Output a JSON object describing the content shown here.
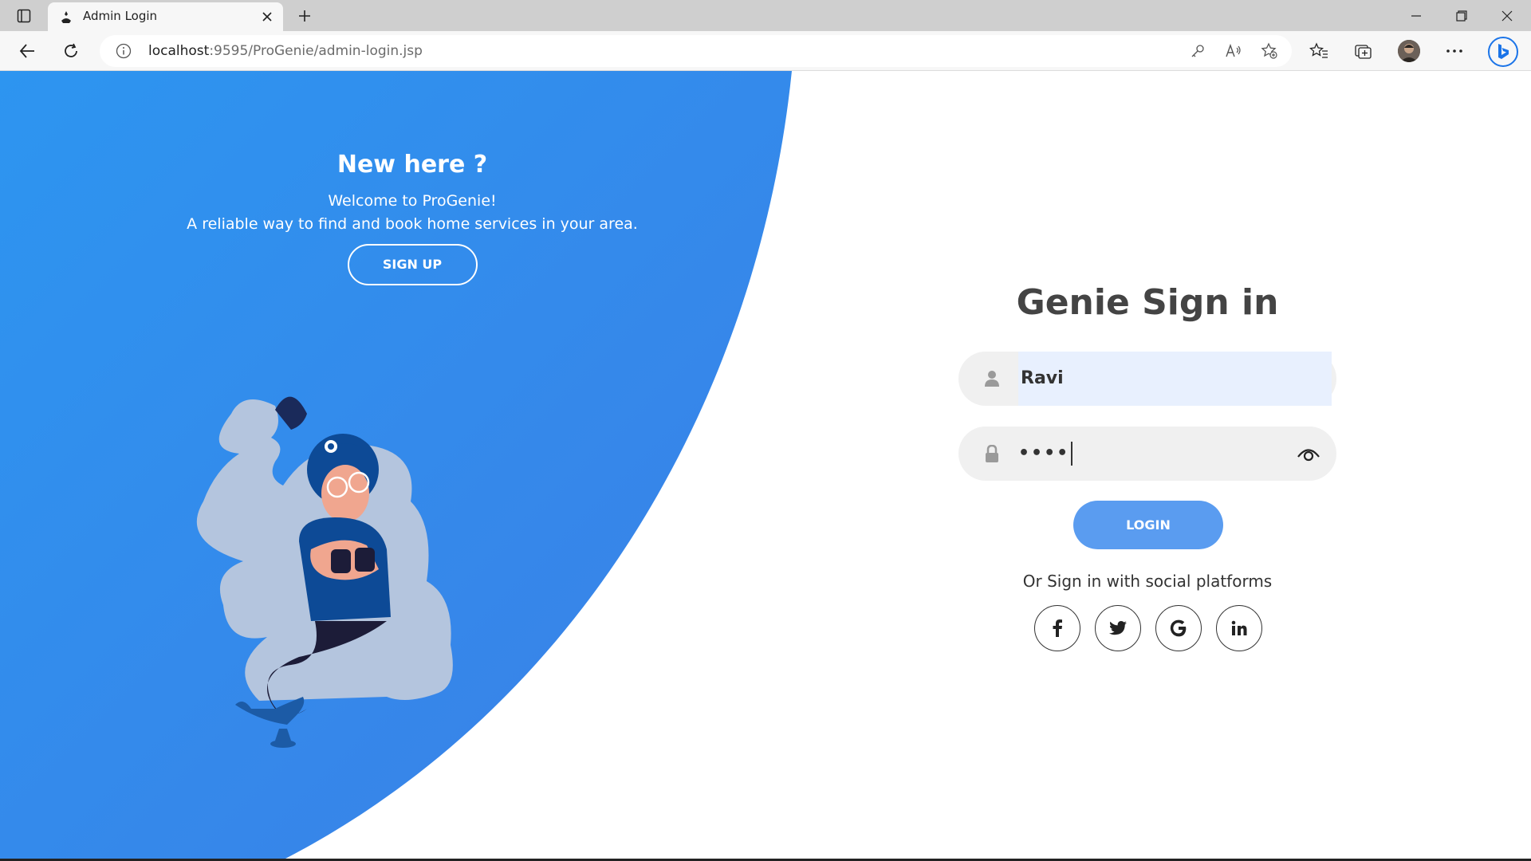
{
  "browser": {
    "tab": {
      "title": "Admin Login"
    },
    "address": {
      "host": "localhost",
      "rest": ":9595/ProGenie/admin-login.jsp"
    }
  },
  "page": {
    "left": {
      "title": "New here ?",
      "subtitle_line1": "Welcome to ProGenie!",
      "subtitle_line2": "A reliable way to find and book home services in your area.",
      "signup_label": "SIGN UP"
    },
    "form": {
      "title": "Genie Sign in",
      "username_value": "Ravi",
      "password_value": "••••",
      "login_label": "LOGIN",
      "social_text": "Or Sign in with social platforms",
      "social": [
        {
          "icon": "facebook-icon",
          "glyph": "f"
        },
        {
          "icon": "twitter-icon",
          "glyph": "t"
        },
        {
          "icon": "google-icon",
          "glyph": "G"
        },
        {
          "icon": "linkedin-icon",
          "glyph": "in"
        }
      ]
    },
    "colors": {
      "panel_blue_start": "#2f8ef0",
      "panel_blue_end": "#3b82e8",
      "login_button": "#5a9cf0",
      "title_text": "#444444"
    }
  }
}
